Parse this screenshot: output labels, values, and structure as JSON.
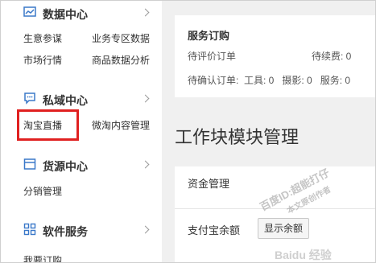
{
  "sidebar": {
    "sections": [
      {
        "title": "数据中心",
        "icon": "data-chart-icon",
        "links": [
          "生意参谋",
          "业务专区数据",
          "市场行情",
          "商品数据分析"
        ]
      },
      {
        "title": "私域中心",
        "icon": "chat-bubble-icon",
        "links": [
          "淘宝直播",
          "微淘内容管理"
        ]
      },
      {
        "title": "货源中心",
        "icon": "box-icon",
        "links": [
          "分销管理"
        ]
      },
      {
        "title": "软件服务",
        "icon": "grid-icon",
        "links": [
          "我要订购"
        ]
      }
    ]
  },
  "main": {
    "orders": {
      "title": "服务订购",
      "pending_review_label": "待评价订单",
      "renewal_label": "待续费: 0",
      "confirm_line": "待确认订单:  工具: 0   摄影: 0   服务: 0"
    },
    "work_module_title": "工作块模块管理",
    "funds": {
      "title": "资金管理",
      "alipay_label": "支付宝余额",
      "show_balance_button": "显示余额"
    }
  },
  "watermark": {
    "line1": "百度ID:超能打仔",
    "line2": "本文原创作者",
    "line3": "Baidu 经验"
  },
  "colors": {
    "highlight": "#e02020",
    "background": "#f0f0f0"
  }
}
